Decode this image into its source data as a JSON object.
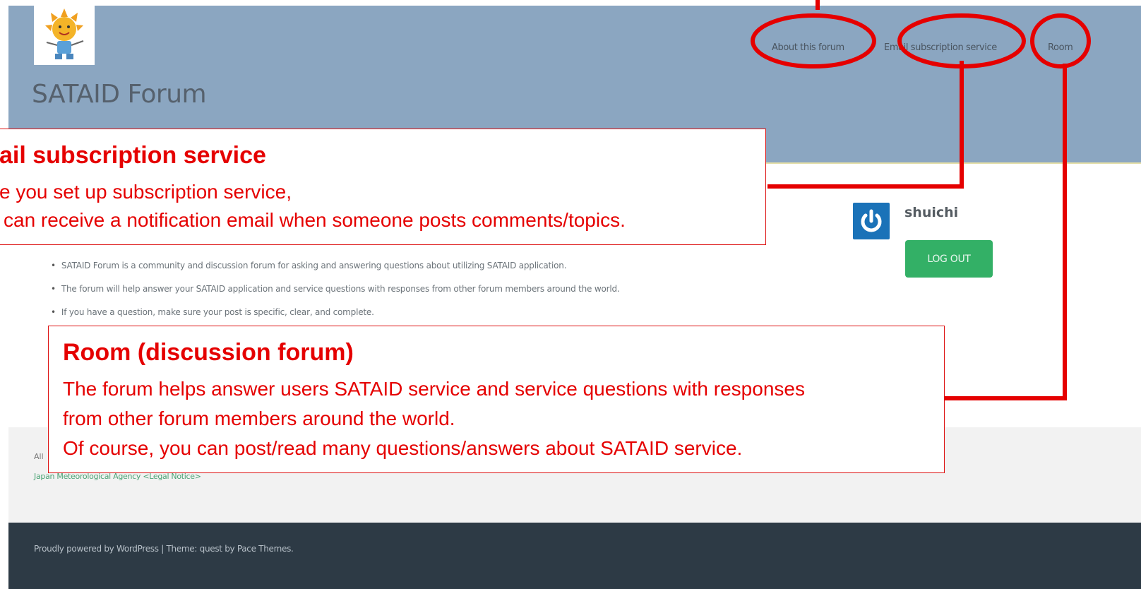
{
  "site": {
    "title": "SATAID Forum",
    "nav": [
      "About this forum",
      "Email subscription service",
      "Room"
    ]
  },
  "user": {
    "name": "shuichi",
    "logout_label": "LOG OUT"
  },
  "content": {
    "bullets": [
      "SATAID Forum is a community and discussion forum for asking and answering questions about utilizing SATAID application.",
      "The forum will help answer your SATAID application and service questions with responses from other forum members around the world.",
      "If you have a question, make sure your post is specific, clear, and complete."
    ]
  },
  "footer": {
    "line1": "All",
    "link": "Japan Meteorological Agency <Legal Notice>",
    "credit": "Proudly powered by WordPress | Theme: quest by Pace Themes."
  },
  "annotations": {
    "email": {
      "title": "ail subscription service",
      "lines": [
        "e you set up subscription service,",
        "can receive a notification email when someone posts  comments/topics."
      ]
    },
    "room": {
      "title": "Room (discussion forum)",
      "lines": [
        "The forum helps answer users SATAID service and service questions with responses",
        "from other forum members around the world.",
        "Of course, you can post/read many questions/answers about SATAID service."
      ]
    },
    "color": "#e50000"
  },
  "colors": {
    "header_bg": "#8ba6c1",
    "logout_bg": "#33b066",
    "avatar_bg": "#1a72b8",
    "footer_dark_bg": "#2d3a45"
  }
}
